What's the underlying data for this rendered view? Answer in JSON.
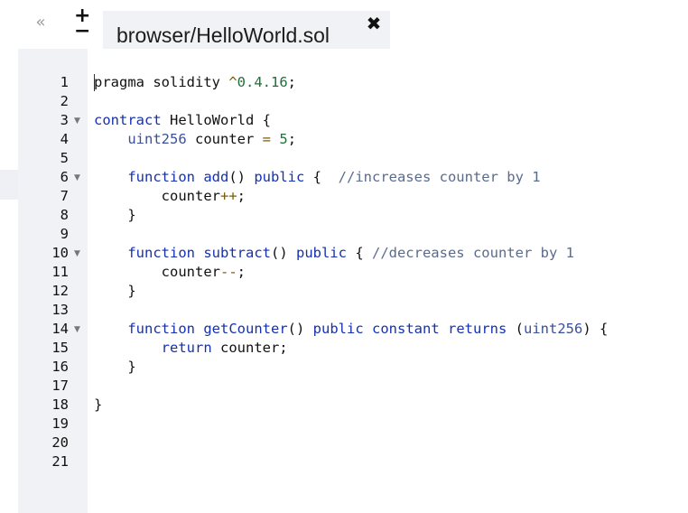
{
  "toolbar": {
    "collapse_icon": "«",
    "zoom_in_icon": "+",
    "zoom_out_icon": "−"
  },
  "tab": {
    "label": "browser/HelloWorld.sol",
    "close_icon": "✖"
  },
  "editor": {
    "lines": [
      {
        "n": "1",
        "fold": false,
        "tokens": [
          [
            "",
            "pragma solidity "
          ],
          [
            "op",
            "^"
          ],
          [
            "num",
            "0.4.16"
          ],
          [
            "",
            ";"
          ]
        ]
      },
      {
        "n": "2",
        "fold": false,
        "tokens": []
      },
      {
        "n": "3",
        "fold": true,
        "tokens": [
          [
            "kw",
            "contract"
          ],
          [
            "",
            " HelloWorld {"
          ]
        ]
      },
      {
        "n": "4",
        "fold": false,
        "tokens": [
          [
            "",
            "    "
          ],
          [
            "ty",
            "uint256"
          ],
          [
            "",
            " counter "
          ],
          [
            "op",
            "="
          ],
          [
            "",
            " "
          ],
          [
            "num",
            "5"
          ],
          [
            "",
            ";"
          ]
        ]
      },
      {
        "n": "5",
        "fold": false,
        "tokens": []
      },
      {
        "n": "6",
        "fold": true,
        "tokens": [
          [
            "",
            "    "
          ],
          [
            "kw",
            "function"
          ],
          [
            "",
            " "
          ],
          [
            "kw",
            "add"
          ],
          [
            "",
            "() "
          ],
          [
            "kw",
            "public"
          ],
          [
            "",
            " {  "
          ],
          [
            "cm",
            "//increases counter by 1"
          ]
        ]
      },
      {
        "n": "7",
        "fold": false,
        "tokens": [
          [
            "",
            "        counter"
          ],
          [
            "op",
            "++"
          ],
          [
            "",
            ";"
          ]
        ]
      },
      {
        "n": "8",
        "fold": false,
        "tokens": [
          [
            "",
            "    }"
          ]
        ]
      },
      {
        "n": "9",
        "fold": false,
        "tokens": []
      },
      {
        "n": "10",
        "fold": true,
        "tokens": [
          [
            "",
            "    "
          ],
          [
            "kw",
            "function"
          ],
          [
            "",
            " "
          ],
          [
            "kw",
            "subtract"
          ],
          [
            "",
            "() "
          ],
          [
            "kw",
            "public"
          ],
          [
            "",
            " { "
          ],
          [
            "cm",
            "//decreases counter by 1"
          ]
        ]
      },
      {
        "n": "11",
        "fold": false,
        "tokens": [
          [
            "",
            "        counter"
          ],
          [
            "op",
            "--"
          ],
          [
            "",
            ";"
          ]
        ]
      },
      {
        "n": "12",
        "fold": false,
        "tokens": [
          [
            "",
            "    }"
          ]
        ]
      },
      {
        "n": "13",
        "fold": false,
        "tokens": []
      },
      {
        "n": "14",
        "fold": true,
        "tokens": [
          [
            "",
            "    "
          ],
          [
            "kw",
            "function"
          ],
          [
            "",
            " "
          ],
          [
            "kw",
            "getCounter"
          ],
          [
            "",
            "() "
          ],
          [
            "kw",
            "public"
          ],
          [
            "",
            " "
          ],
          [
            "kw",
            "constant"
          ],
          [
            "",
            " "
          ],
          [
            "kw",
            "returns"
          ],
          [
            "",
            " ("
          ],
          [
            "ty",
            "uint256"
          ],
          [
            "",
            ") {"
          ]
        ]
      },
      {
        "n": "15",
        "fold": false,
        "tokens": [
          [
            "",
            "        "
          ],
          [
            "kw",
            "return"
          ],
          [
            "",
            " counter;"
          ]
        ]
      },
      {
        "n": "16",
        "fold": false,
        "tokens": [
          [
            "",
            "    }"
          ]
        ]
      },
      {
        "n": "17",
        "fold": false,
        "tokens": []
      },
      {
        "n": "18",
        "fold": false,
        "tokens": [
          [
            "",
            "}"
          ]
        ]
      },
      {
        "n": "19",
        "fold": false,
        "tokens": []
      },
      {
        "n": "20",
        "fold": false,
        "tokens": []
      },
      {
        "n": "21",
        "fold": false,
        "tokens": []
      }
    ]
  }
}
